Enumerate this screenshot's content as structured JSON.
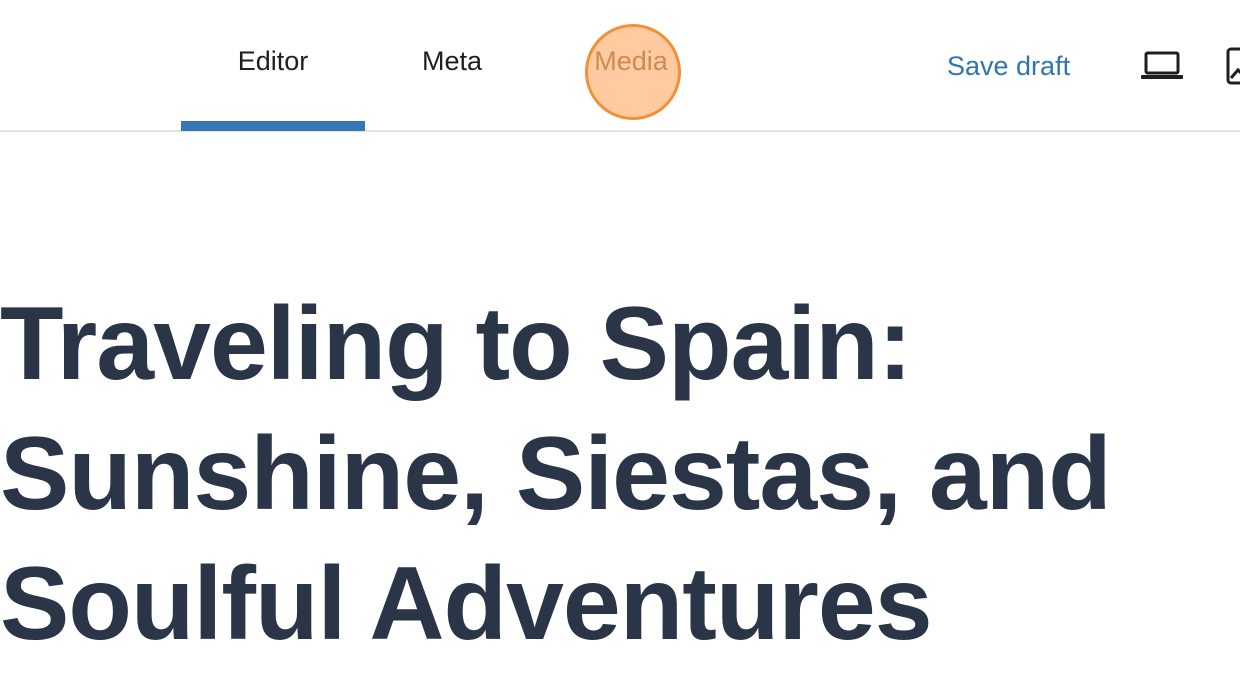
{
  "tabs": [
    {
      "label": "Editor",
      "active": true
    },
    {
      "label": "Meta",
      "active": false
    },
    {
      "label": "Media",
      "active": false
    }
  ],
  "actions": {
    "save_draft_label": "Save draft",
    "preview_icon": "laptop-icon",
    "media_icon": "image-icon"
  },
  "post": {
    "title": "Traveling to Spain: Sunshine, Siestas, and Soulful Adventures"
  },
  "colors": {
    "accent": "#3777b8",
    "link": "#2f75b0",
    "title_text": "#2a3547",
    "click_highlight": "#f0913a"
  }
}
